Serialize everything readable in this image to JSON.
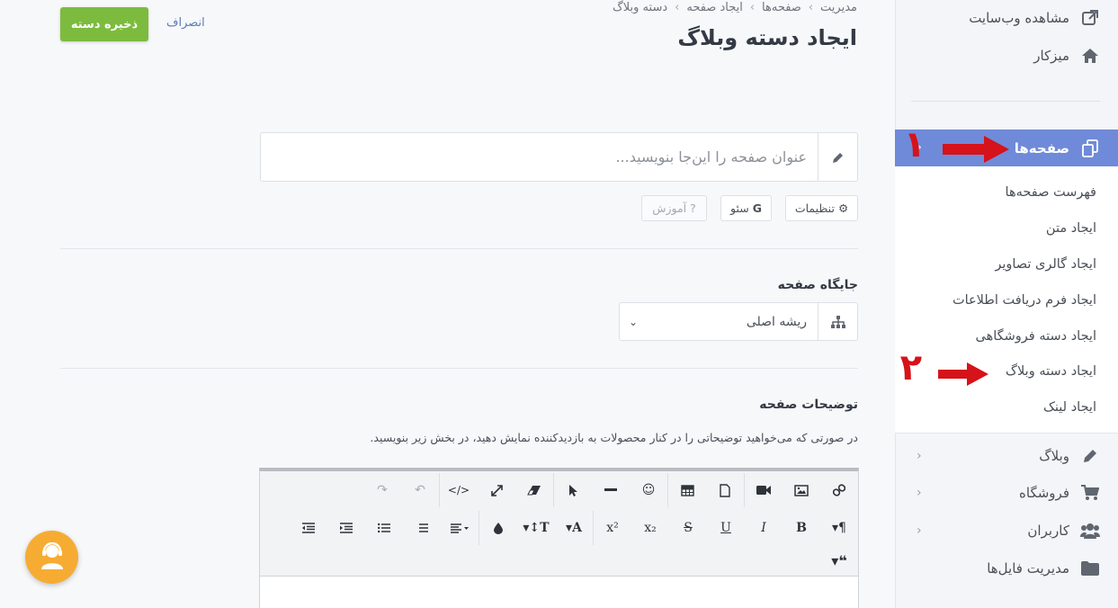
{
  "header": {
    "breadcrumb": [
      "مدیریت",
      "صفحه‌ها",
      "ایجاد صفحه",
      "دسته وبلاگ"
    ],
    "title": "ایجاد دسته وبلاگ",
    "save_label": "ذخیره دسته",
    "cancel_label": "انصراف"
  },
  "sidebar": {
    "top": [
      {
        "label": "مشاهده وب‌سایت",
        "icon": "external-link-icon"
      },
      {
        "label": "میزکار",
        "icon": "home-icon"
      }
    ],
    "active": {
      "label": "صفحه‌ها",
      "icon": "pages-icon"
    },
    "sub": [
      "فهرست صفحه‌ها",
      "ایجاد متن",
      "ایجاد گالری تصاویر",
      "ایجاد فرم دریافت اطلاعات",
      "ایجاد دسته فروشگاهی",
      "ایجاد دسته وبلاگ",
      "ایجاد لینک"
    ],
    "bottom": [
      {
        "label": "وبلاگ",
        "icon": "pencil-icon"
      },
      {
        "label": "فروشگاه",
        "icon": "cart-icon"
      },
      {
        "label": "کاربران",
        "icon": "users-icon"
      },
      {
        "label": "مدیریت فایل‌ها",
        "icon": "folder-icon"
      }
    ]
  },
  "annotations": {
    "first": "۱",
    "second": "۲",
    "color": "#d6121a"
  },
  "form": {
    "title_placeholder": "عنوان صفحه را این‌جا بنویسید...",
    "chips": {
      "settings": "تنظیمات",
      "seo": "سئو",
      "tutorial": "آموزش"
    },
    "position_label": "جایگاه صفحه",
    "position_value": "ریشه اصلی",
    "description_label": "توضیحات صفحه",
    "description_hint": "در صورتی که می‌خواهید توضیحاتی را در کنار محصولات به بازدیدکننده نمایش دهید، در بخش زیر بنویسید."
  },
  "editor": {
    "row1": [
      "link-icon",
      "image-icon",
      "video-icon",
      "file-icon",
      "table-icon",
      "emoji-icon",
      "horizontal-rule-icon",
      "cursor-icon",
      "eraser-icon",
      "fullscreen-icon",
      "code-view-icon",
      "undo-icon",
      "redo-icon"
    ],
    "row2": [
      "paragraph-icon",
      "bold-icon",
      "italic-icon",
      "underline-icon",
      "strikethrough-icon",
      "subscript-icon",
      "superscript-icon",
      "font-color-icon",
      "font-size-icon",
      "color-drop-icon",
      "align-icon",
      "ordered-list-icon",
      "unordered-list-icon",
      "indent-icon",
      "outdent-icon"
    ],
    "row3": [
      "quote-icon"
    ]
  },
  "colors": {
    "accent": "#6f8ad8",
    "save": "#7dbb3e",
    "support": "#f6ac32"
  }
}
